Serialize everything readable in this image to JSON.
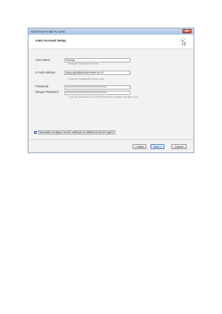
{
  "window": {
    "title": "Add New E-mail Account",
    "close_glyph": "✕"
  },
  "header": {
    "title": "Auto Account Setup",
    "icon": "cursor-click-icon"
  },
  "form": {
    "name_label": "Your Name:",
    "name_value": "Polman",
    "name_hint": "Example: Barbara Sankovic",
    "email_label": "E-mail Address:",
    "email_value": "yang.agha@polman-babel.ac.id",
    "email_hint": "Example: barbara@contoso.com",
    "password_label": "Password:",
    "password_value": "****************************************",
    "retype_label": "Retype Password:",
    "retype_value": "****************************************",
    "password_hint": "Type the password your Internet service provider has given you."
  },
  "manual_config": {
    "checked": true,
    "label": "Manually configure server settings or additional server types"
  },
  "buttons": {
    "back": "< Back",
    "next": "Next >",
    "cancel": "Cancel"
  }
}
